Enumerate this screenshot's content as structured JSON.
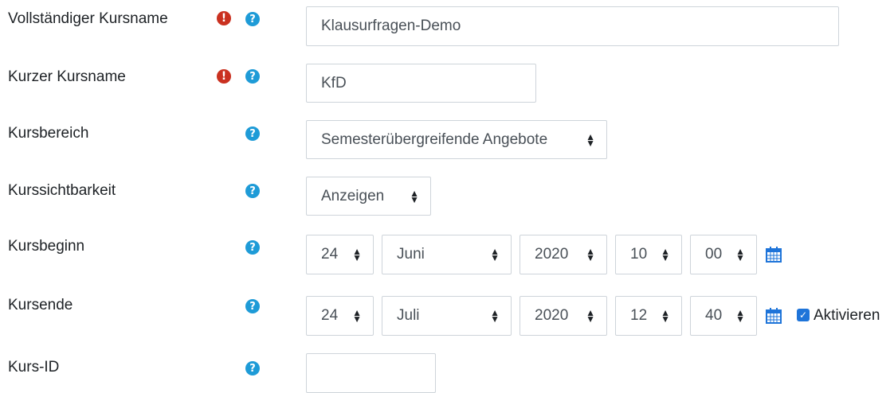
{
  "fields": {
    "fullname": {
      "label": "Vollständiger Kursname",
      "value": "Klausurfragen-Demo"
    },
    "shortname": {
      "label": "Kurzer Kursname",
      "value": "KfD"
    },
    "category": {
      "label": "Kursbereich",
      "value": "Semesterübergreifende Angebote"
    },
    "visibility": {
      "label": "Kurssichtbarkeit",
      "value": "Anzeigen"
    },
    "startdate": {
      "label": "Kursbeginn",
      "day": "24",
      "month": "Juni",
      "year": "2020",
      "hour": "10",
      "minute": "00"
    },
    "enddate": {
      "label": "Kursende",
      "day": "24",
      "month": "Juli",
      "year": "2020",
      "hour": "12",
      "minute": "40",
      "enable_label": "Aktivieren",
      "enabled": true
    },
    "idnumber": {
      "label": "Kurs-ID",
      "value": ""
    }
  },
  "icons": {
    "required": "exclamation-circle-icon",
    "help": "question-circle-icon",
    "calendar": "calendar-icon"
  },
  "colors": {
    "required": "#ca3120",
    "help": "#1e9bd7",
    "calendar": "#1e74d9",
    "checkbox": "#1e74d9"
  }
}
